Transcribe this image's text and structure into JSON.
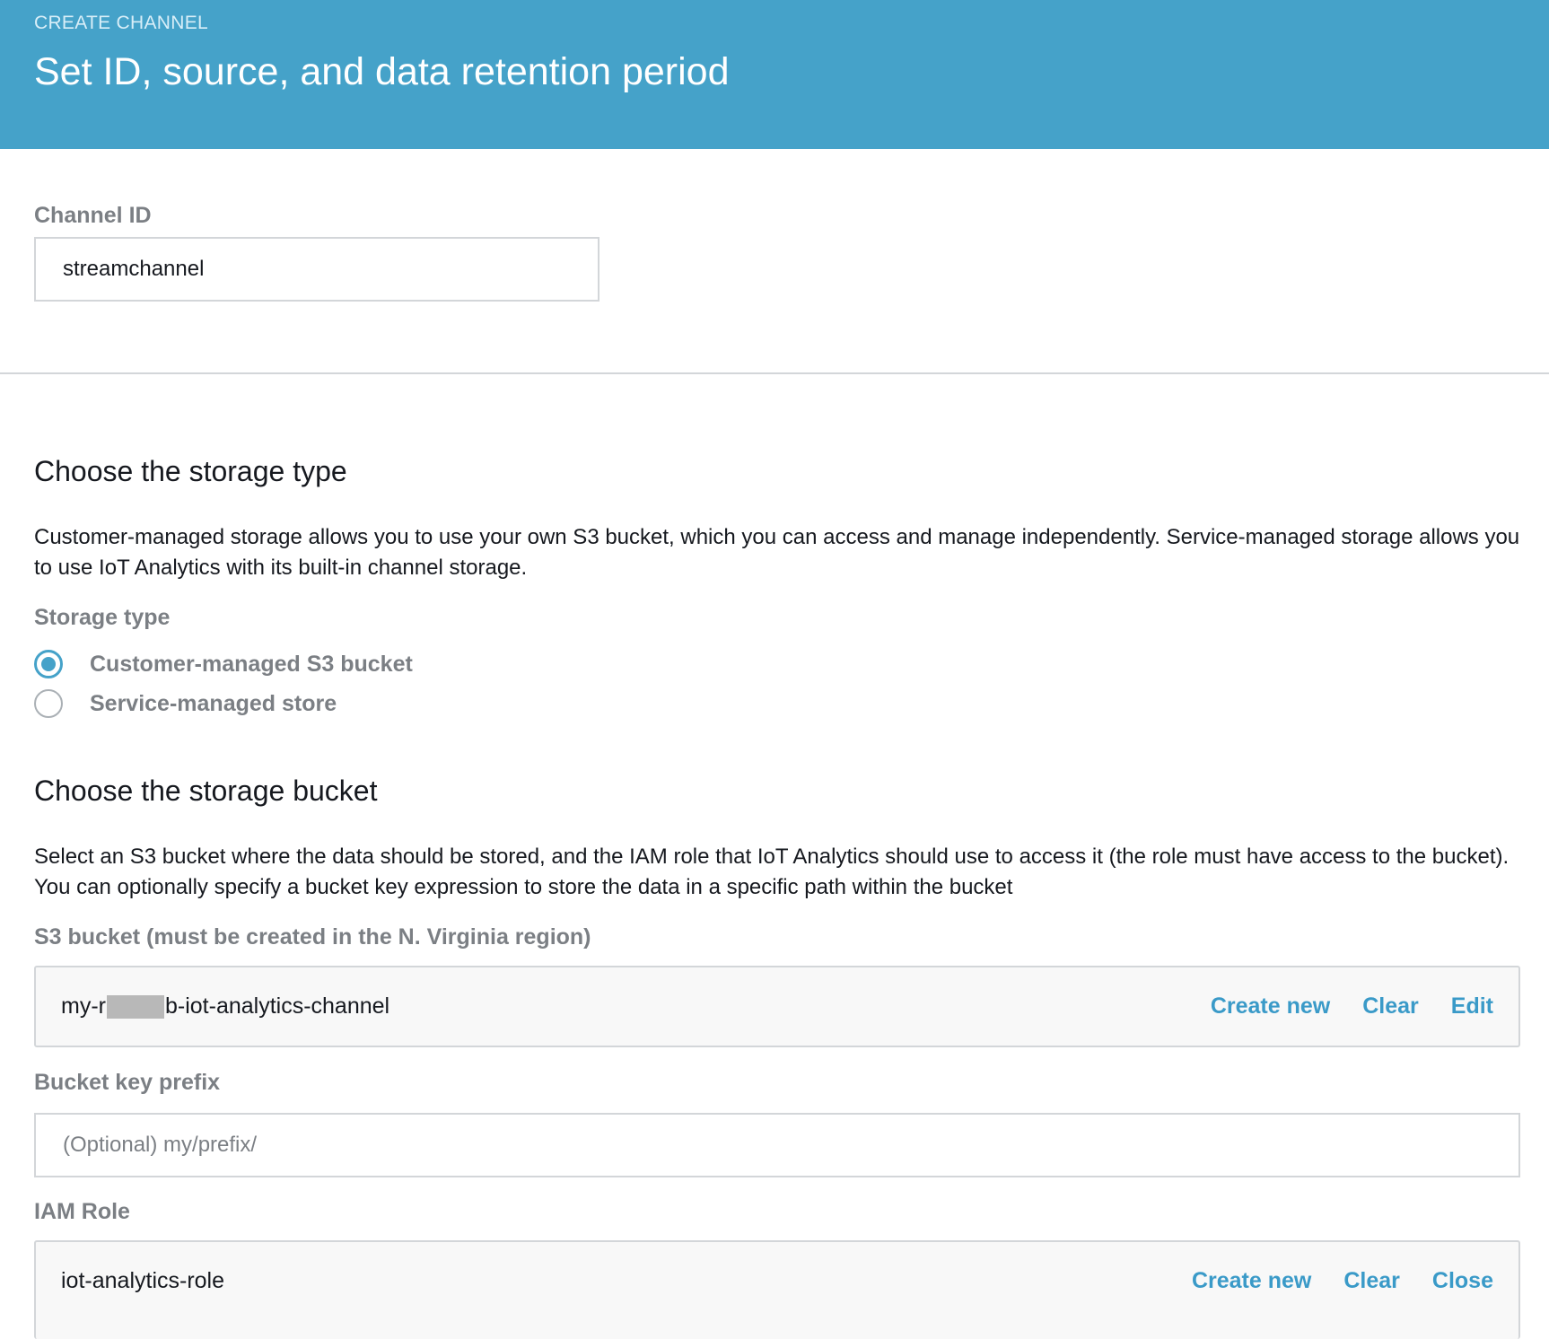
{
  "header": {
    "eyebrow": "CREATE CHANNEL",
    "title": "Set ID, source, and data retention period"
  },
  "channel_id": {
    "label": "Channel ID",
    "value": "streamchannel"
  },
  "storage_type_section": {
    "heading": "Choose the storage type",
    "description": "Customer-managed storage allows you to use your own S3 bucket, which you can access and manage independently. Service-managed storage allows you to use IoT Analytics with its built-in channel storage.",
    "field_label": "Storage type",
    "options": [
      {
        "label": "Customer-managed S3 bucket",
        "selected": true
      },
      {
        "label": "Service-managed store",
        "selected": false
      }
    ]
  },
  "storage_bucket_section": {
    "heading": "Choose the storage bucket",
    "description": "Select an S3 bucket where the data should be stored, and the IAM role that IoT Analytics should use to access it (the role must have access to the bucket). You can optionally specify a bucket key expression to store the data in a specific path within the bucket",
    "s3_bucket": {
      "label": "S3 bucket (must be created in the N. Virginia region)",
      "value_prefix": "my-r",
      "value_suffix": "b-iot-analytics-channel",
      "actions": {
        "create_new": "Create new",
        "clear": "Clear",
        "edit": "Edit"
      }
    },
    "bucket_key_prefix": {
      "label": "Bucket key prefix",
      "placeholder": "(Optional) my/prefix/"
    },
    "iam_role": {
      "label": "IAM Role",
      "value": "iot-analytics-role",
      "actions": {
        "create_new": "Create new",
        "clear": "Clear",
        "close": "Close"
      }
    }
  },
  "colors": {
    "header_bg": "#45a2c9",
    "link": "#3a9ac8",
    "label_gray": "#7b7f84"
  }
}
